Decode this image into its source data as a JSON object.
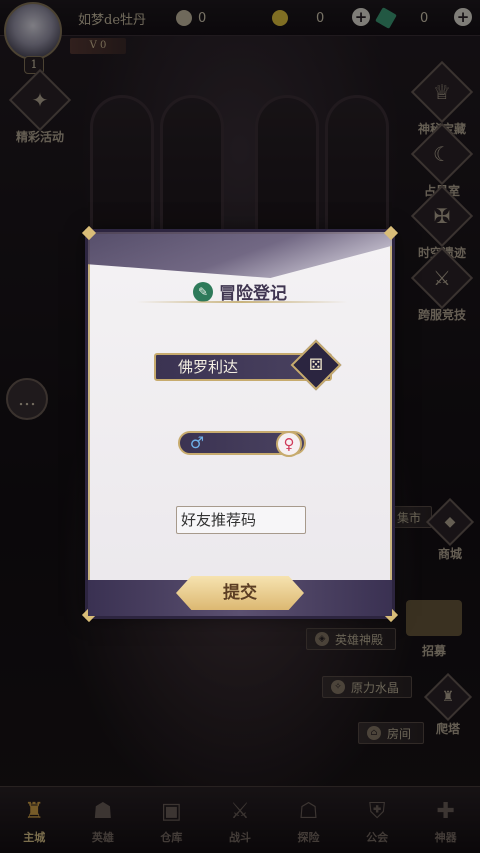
{
  "player": {
    "name": "如梦de牡丹",
    "level": "1",
    "vip": "V 0"
  },
  "resources": [
    {
      "icon": "stamina-icon",
      "value": "0"
    },
    {
      "icon": "gold-coin-icon",
      "value": "0"
    },
    {
      "icon": "feather-gem-icon",
      "value": "0"
    }
  ],
  "left_menu": [
    {
      "icon": "event-star-icon",
      "label": "精彩活动"
    }
  ],
  "right_menu": [
    {
      "icon": "treasure-icon",
      "label": "神秘宝藏"
    },
    {
      "icon": "astrology-icon",
      "label": "占星室"
    },
    {
      "icon": "sword-icon",
      "label": "时空遗迹"
    },
    {
      "icon": "arena-icon",
      "label": "跨服竞技"
    }
  ],
  "right_lower_menu": [
    {
      "label": "集市"
    },
    {
      "label": "商城"
    },
    {
      "label": "招募"
    },
    {
      "label": "爬塔"
    }
  ],
  "scene_plates": [
    {
      "label": "英雄神殿"
    },
    {
      "label": "原力水晶"
    },
    {
      "label": "房间"
    }
  ],
  "bottom_nav": [
    {
      "icon": "castle-icon",
      "label": "主城"
    },
    {
      "icon": "hero-icon",
      "label": "英雄"
    },
    {
      "icon": "warehouse-icon",
      "label": "仓库"
    },
    {
      "icon": "battle-icon",
      "label": "战斗"
    },
    {
      "icon": "explore-icon",
      "label": "探险"
    },
    {
      "icon": "guild-icon",
      "label": "公会"
    },
    {
      "icon": "artifact-icon",
      "label": "神器"
    }
  ],
  "modal": {
    "title": "冒险登记",
    "name_value": "佛罗利达",
    "male_symbol": "♂",
    "female_symbol": "♀",
    "referral_placeholder": "好友推荐码",
    "submit_label": "提交"
  },
  "colors": {
    "modal_accent": "#c9b47e",
    "modal_dark": "#3b3352",
    "female_pink": "#d03a5a",
    "male_blue": "#6fb0e8"
  }
}
